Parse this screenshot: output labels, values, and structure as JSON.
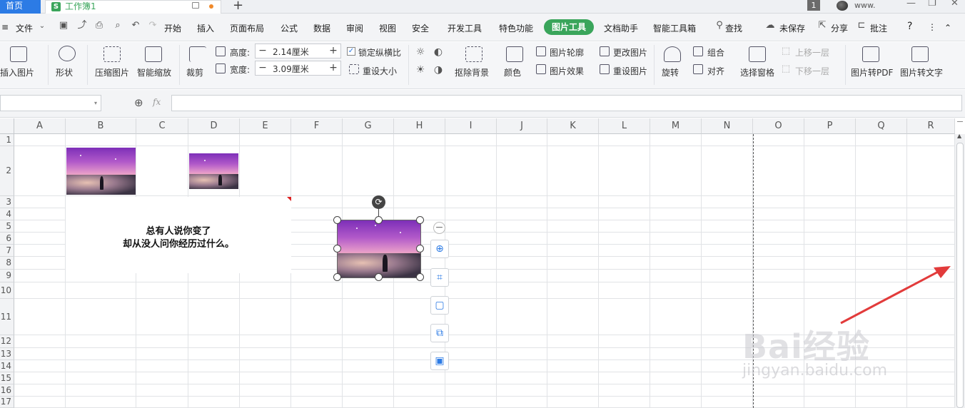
{
  "tabbar": {
    "home": "首页",
    "doc_name": "工作簿1",
    "doc_icon_letter": "S",
    "new_tab": "+",
    "badge": "1",
    "user": "www."
  },
  "window_controls": {
    "minimize": "—",
    "restore": "❐",
    "close": "✕"
  },
  "menu": {
    "file": "文件",
    "items": [
      "开始",
      "插入",
      "页面布局",
      "公式",
      "数据",
      "审阅",
      "视图",
      "安全",
      "开发工具",
      "特色功能",
      "图片工具",
      "文档助手",
      "智能工具箱"
    ],
    "active": "图片工具",
    "search": "查找",
    "unsaved": "未保存",
    "share": "分享",
    "comment": "批注",
    "help": "?",
    "more": "⋮",
    "collapse": "⌃"
  },
  "ribbon": {
    "insert_image": "插入图片",
    "shape": "形状",
    "compress": "压缩图片",
    "smart_scale": "智能缩放",
    "crop": "裁剪",
    "height_label": "高度:",
    "height_value": "2.14厘米",
    "width_label": "宽度:",
    "width_value": "3.09厘米",
    "lock_ratio": "锁定纵横比",
    "reset_size": "重设大小",
    "remove_bg": "抠除背景",
    "color": "颜色",
    "outline": "图片轮廓",
    "effect": "图片效果",
    "change_image": "更改图片",
    "reset_image": "重设图片",
    "rotate": "旋转",
    "group": "组合",
    "align": "对齐",
    "select_pane": "选择窗格",
    "bring_forward": "上移一层",
    "send_backward": "下移一层",
    "to_pdf": "图片转PDF",
    "to_text": "图片转文字"
  },
  "formula_bar": {
    "fx": "fx",
    "name_box": "",
    "formula": ""
  },
  "grid": {
    "columns": [
      "A",
      "B",
      "C",
      "D",
      "E",
      "F",
      "G",
      "H",
      "I",
      "J",
      "K",
      "L",
      "M",
      "N",
      "O",
      "P",
      "Q",
      "R"
    ],
    "rows": [
      "1",
      "2",
      "3",
      "4",
      "5",
      "6",
      "7",
      "8",
      "9",
      "10",
      "11",
      "12",
      "13",
      "14",
      "15",
      "16",
      "17"
    ]
  },
  "textbox": {
    "line1": "总有人说你变了",
    "line2": "却从没人问你经历过什么。"
  },
  "watermark": {
    "brand": "Bai经验",
    "url": "jingyan.baidu.com"
  },
  "colors": {
    "accent": "#3aa55b",
    "home_tab": "#2c7be5",
    "arrow": "#e23b3b"
  }
}
